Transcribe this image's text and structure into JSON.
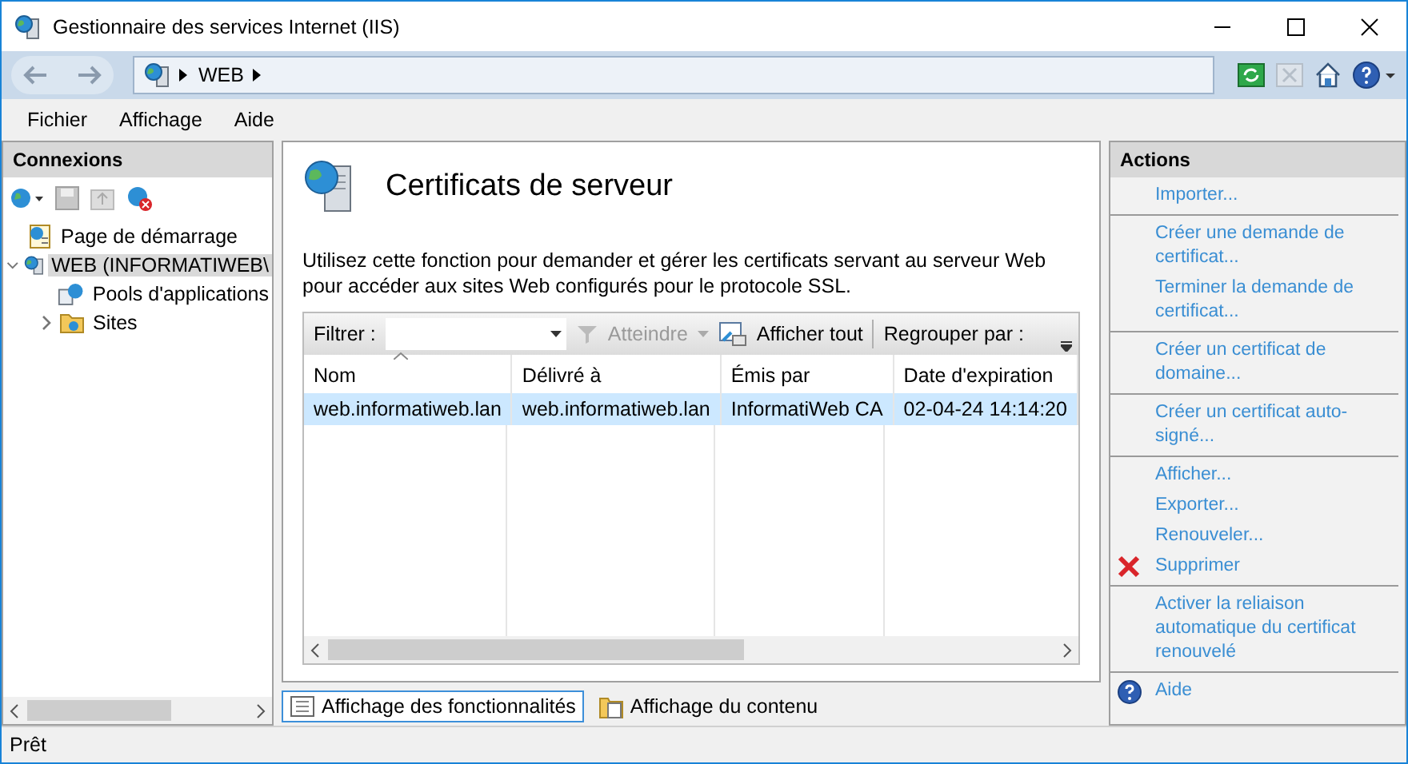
{
  "window": {
    "title": "Gestionnaire des services Internet (IIS)"
  },
  "address_bar": {
    "segments": [
      "WEB"
    ]
  },
  "menu": [
    "Fichier",
    "Affichage",
    "Aide"
  ],
  "connections": {
    "title": "Connexions",
    "tree": [
      {
        "label": "Page de démarrage",
        "kind": "start",
        "selected": false
      },
      {
        "label": "WEB (INFORMATIWEB\\",
        "kind": "server",
        "selected": true,
        "expanded": true,
        "children": [
          {
            "label": "Pools d'applications",
            "kind": "pools",
            "selected": false
          },
          {
            "label": "Sites",
            "kind": "sites",
            "selected": false,
            "expanded": false
          }
        ]
      }
    ]
  },
  "feature": {
    "title": "Certificats de serveur",
    "description": "Utilisez cette fonction pour demander et gérer les certificats servant au serveur Web pour accéder aux sites Web configurés pour le protocole SSL.",
    "filter": {
      "label": "Filtrer :",
      "go": "Atteindre",
      "show_all": "Afficher tout",
      "group_by": "Regrouper par :"
    },
    "table": {
      "columns": [
        "Nom",
        "Délivré à",
        "Émis par",
        "Date d'expiration"
      ],
      "rows": [
        {
          "cells": [
            "web.informatiweb.lan",
            "web.informatiweb.lan",
            "InformatiWeb CA",
            "02-04-24 14:14:20"
          ],
          "selected": true
        }
      ]
    }
  },
  "view_tabs": [
    {
      "label": "Affichage des fonctionnalités",
      "kind": "features",
      "selected": true
    },
    {
      "label": "Affichage du contenu",
      "kind": "content",
      "selected": false
    }
  ],
  "actions": {
    "title": "Actions",
    "groups": [
      [
        {
          "label": "Importer..."
        }
      ],
      [
        {
          "label": "Créer une demande de certificat..."
        },
        {
          "label": "Terminer la demande de certificat..."
        }
      ],
      [
        {
          "label": "Créer un certificat de domaine..."
        }
      ],
      [
        {
          "label": "Créer un certificat auto-signé..."
        }
      ],
      [
        {
          "label": "Afficher..."
        },
        {
          "label": "Exporter..."
        },
        {
          "label": "Renouveler..."
        },
        {
          "label": "Supprimer",
          "kind": "delete"
        }
      ],
      [
        {
          "label": "Activer la reliaison automatique du certificat renouvelé"
        }
      ],
      [
        {
          "label": "Aide",
          "kind": "help"
        }
      ]
    ]
  },
  "status_bar": "Prêt"
}
